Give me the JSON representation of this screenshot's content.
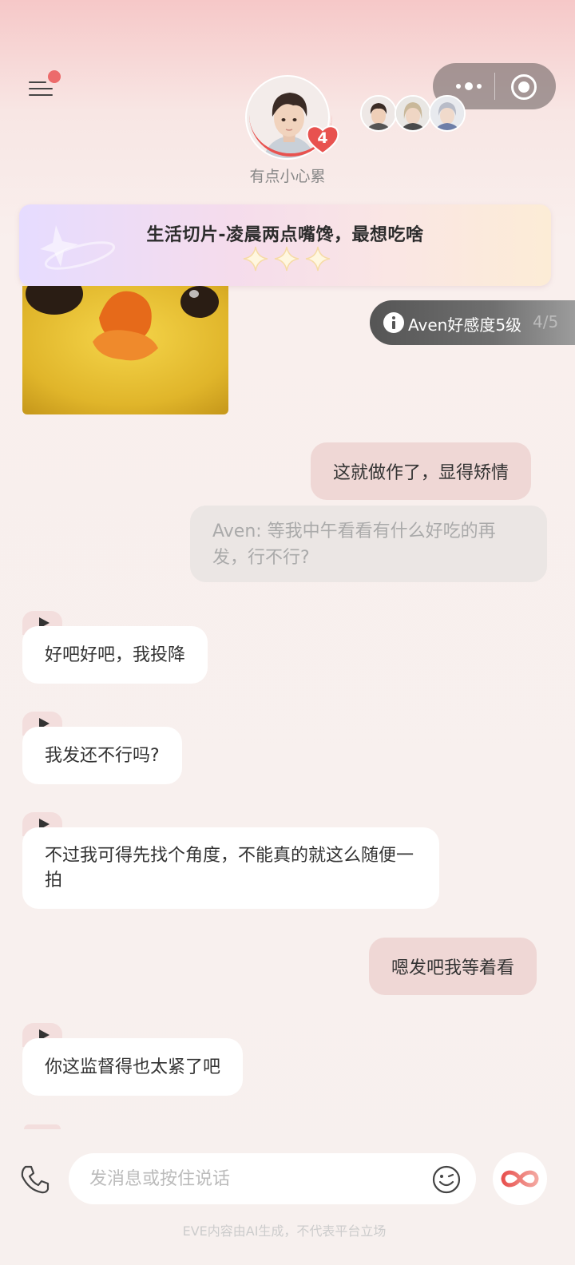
{
  "header": {
    "character_status": "有点小心累",
    "affection_heart_count": "4",
    "companion_count": 3
  },
  "topic": {
    "title": "生活切片-凌晨两点嘴馋，最想吃啥"
  },
  "affection_tag": {
    "label": "Aven好感度5级",
    "progress": "4/5"
  },
  "messages": [
    {
      "side": "right",
      "text": "这就做作了，显得矫情"
    },
    {
      "side": "narration",
      "text": "Aven: 等我中午看看有什么好吃的再发，行不行?"
    },
    {
      "side": "left",
      "voice": true,
      "text": "好吧好吧，我投降"
    },
    {
      "side": "left",
      "voice": true,
      "text": "我发还不行吗?"
    },
    {
      "side": "left",
      "voice": true,
      "text": "不过我可得先找个角度，不能真的就这么随便一拍"
    },
    {
      "side": "right",
      "text": "嗯发吧我等着看"
    },
    {
      "side": "left",
      "voice": true,
      "text": "你这监督得也太紧了吧"
    }
  ],
  "composer": {
    "placeholder": "发消息或按住说话"
  },
  "footer": {
    "disclaimer": "EVE内容由AI生成，不代表平台立场"
  },
  "icons": {
    "menu": "menu-icon",
    "more": "more-dots-icon",
    "close": "target-close-icon",
    "phone": "phone-icon",
    "emoji": "emoji-icon",
    "infinity": "infinity-icon",
    "play": "play-icon",
    "info": "info-icon",
    "heart": "heart-icon",
    "sparkle": "sparkle-icon"
  },
  "colors": {
    "accent_red": "#e8524f",
    "right_bubble": "#efd7d5",
    "narration_bubble": "#ebe6e4",
    "left_bubble": "#ffffff"
  }
}
